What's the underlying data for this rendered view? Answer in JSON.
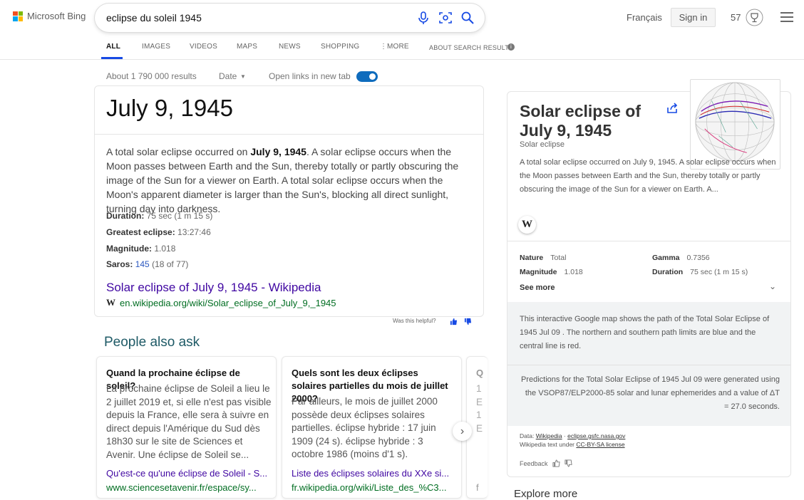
{
  "header": {
    "logo_text": "Microsoft Bing",
    "search_value": "eclipse du soleil 1945",
    "language": "Français",
    "signin": "Sign in",
    "rewards_count": "57"
  },
  "tabs": [
    "ALL",
    "IMAGES",
    "VIDEOS",
    "MAPS",
    "NEWS",
    "SHOPPING",
    "MORE",
    "ABOUT SEARCH RESULTS"
  ],
  "filters": {
    "results_count": "About 1 790 000 results",
    "date": "Date",
    "open_links": "Open links in new tab"
  },
  "answer": {
    "date": "July 9, 1945",
    "desc_pre": "A total solar eclipse occurred on ",
    "desc_bold": "July 9, 1945",
    "desc_post": ". A solar eclipse occurs when the Moon passes between Earth and the Sun, thereby totally or partly obscuring the image of the Sun for a viewer on Earth. A total solar eclipse occurs when the Moon's apparent diameter is larger than the Sun's, blocking all direct sunlight, turning day into darkness.",
    "facts": [
      {
        "label": "Duration:",
        "value": " 75 sec (1 m 15 s)"
      },
      {
        "label": "Greatest eclipse:",
        "value": " 13:27:46"
      },
      {
        "label": "Magnitude:",
        "value": " 1.018"
      }
    ],
    "saros_label": "Saros:",
    "saros_link": "145",
    "saros_rest": " (18 of 77)",
    "wiki_title": "Solar eclipse of July 9, 1945 - Wikipedia",
    "wiki_url": "en.wikipedia.org/wiki/Solar_eclipse_of_July_9,_1945",
    "helpful": "Was this helpful?"
  },
  "paa": {
    "title": "People also ask",
    "cards": [
      {
        "q": "Quand la prochaine éclipse de soleil?",
        "a": "La prochaine éclipse de Soleil a lieu le 2 juillet 2019 et, si elle n'est pas visible depuis la France, elle sera à suivre en direct depuis l'Amérique du Sud dès 18h30 sur le site de Sciences et Avenir. Une éclipse de Soleil se...",
        "link": "Qu'est-ce qu'une éclipse de Soleil - S...",
        "url": "www.sciencesetavenir.fr/espace/sy..."
      },
      {
        "q": "Quels sont les deux éclipses solaires partielles du mois de juillet 2000?",
        "a": "Par ailleurs, le mois de juillet 2000 possède deux éclipses solaires partielles. éclipse hybride : 17 juin 1909 (24 s). éclipse hybride : 3 octobre 1986 (moins d'1 s).",
        "link": "Liste des éclipses solaires du XXe si...",
        "url": "fr.wikipedia.org/wiki/Liste_des_%C3..."
      },
      {
        "q": "Q",
        "a": "1 E 1 E",
        "link": "",
        "url": "f"
      }
    ]
  },
  "panel": {
    "title": "Solar eclipse of July 9, 1945",
    "subtitle": "Solar eclipse",
    "desc": "A total solar eclipse occurred on July 9, 1945. A solar eclipse occurs when the Moon passes between Earth and the Sun, thereby totally or partly obscuring the image of the Sun for a viewer on Earth. A...",
    "wiki_glyph": "W",
    "facts": [
      {
        "label": "Nature",
        "value": "Total"
      },
      {
        "label": "Gamma",
        "value": "0.7356"
      },
      {
        "label": "Magnitude",
        "value": "1.018"
      },
      {
        "label": "Duration",
        "value": "75 sec (1 m 15 s)"
      }
    ],
    "see_more": "See more",
    "map_note": "This interactive Google map shows the path of the Total Solar Eclipse of 1945 Jul 09 . The northern and southern path limits are blue and the central line is red.",
    "predictions": "Predictions for the Total Solar Eclipse of 1945 Jul 09 were generated using the VSOP87/ELP2000-85 solar and lunar ephemerides and a value of ΔT = 27.0 seconds.",
    "data_label": "Data:",
    "data_src1": "Wikipedia",
    "data_src2": "eclipse.gsfc.nasa.gov",
    "wiki_text": "Wikipedia text under",
    "license": "CC-BY-SA license",
    "feedback": "Feedback"
  },
  "explore": "Explore more"
}
